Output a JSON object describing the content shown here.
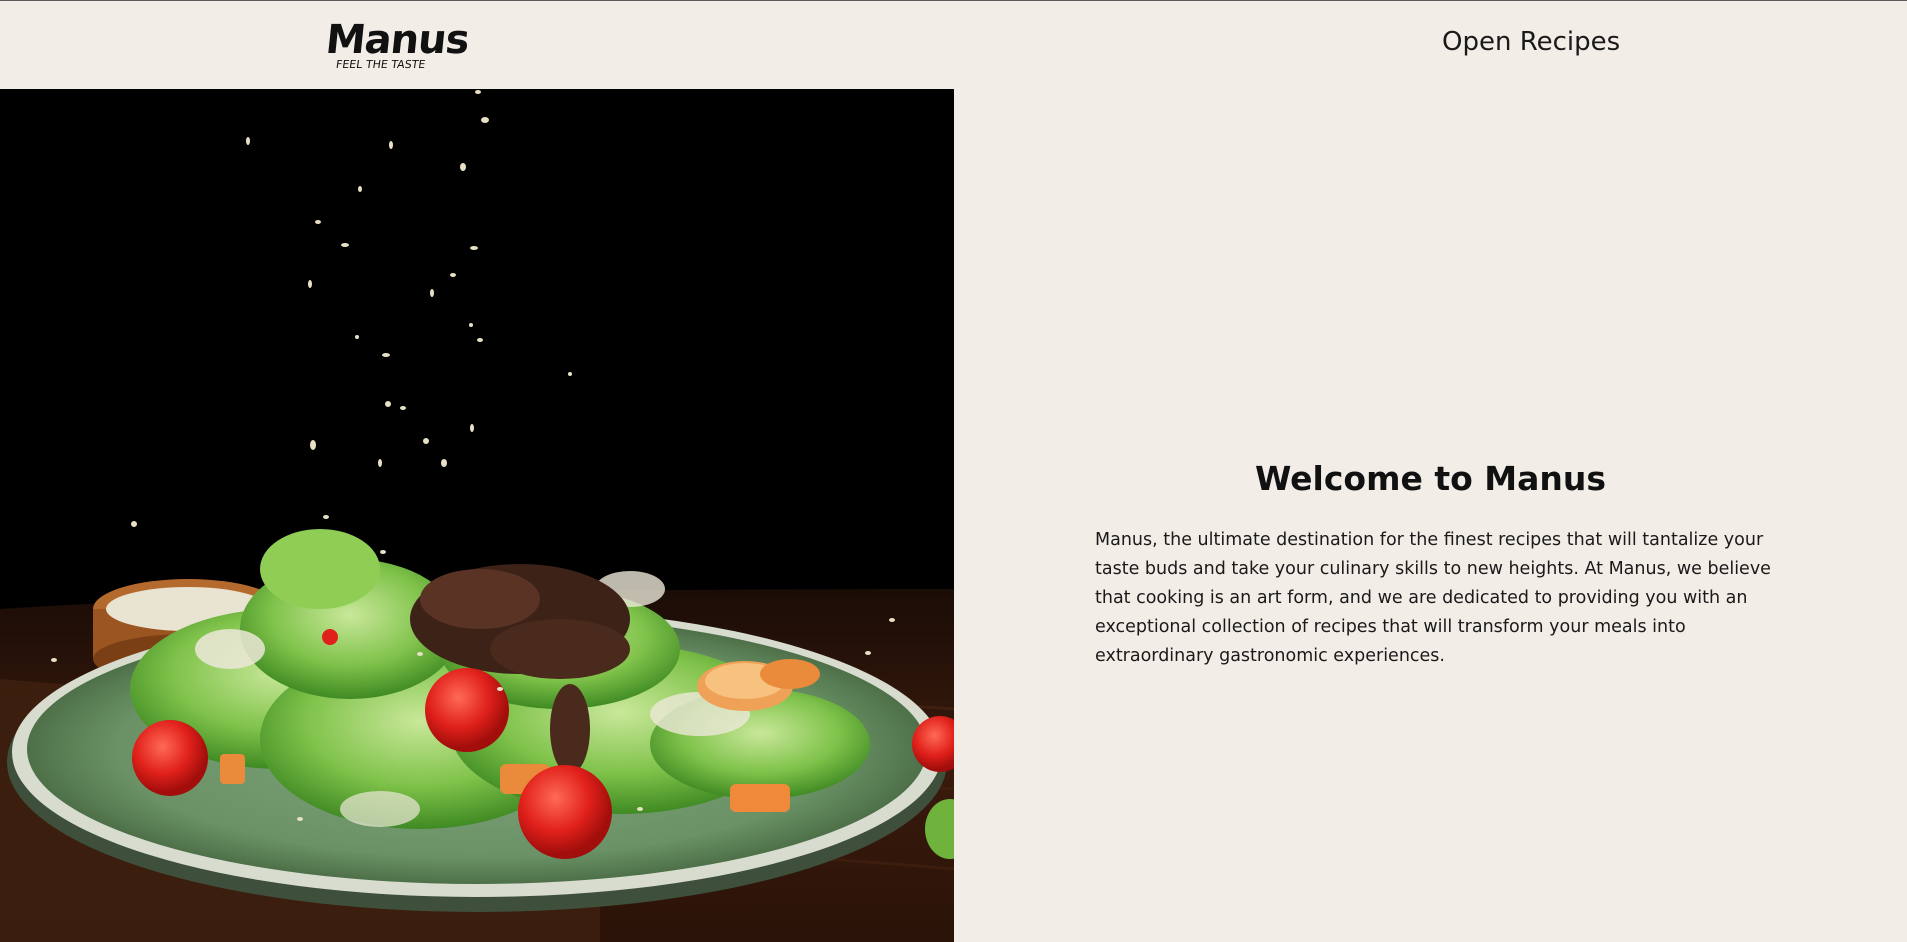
{
  "header": {
    "logo": {
      "name": "Manus",
      "tagline": "FEEL THE TASTE"
    },
    "nav": {
      "open_recipes": "Open Recipes"
    }
  },
  "hero": {
    "image": {
      "subject": "salad-plate-photo",
      "background_color": "#000000"
    }
  },
  "main": {
    "title": "Welcome to Manus",
    "description": "Manus, the ultimate destination for the finest recipes that will tantalize your taste buds and take your culinary skills to new heights. At Manus, we believe that cooking is an art form, and we are dedicated to providing you with an exceptional collection of recipes that will transform your meals into extraordinary gastronomic experiences."
  },
  "colors": {
    "page_background": "#f2ede7",
    "text": "#111111",
    "image_background": "#000000"
  }
}
